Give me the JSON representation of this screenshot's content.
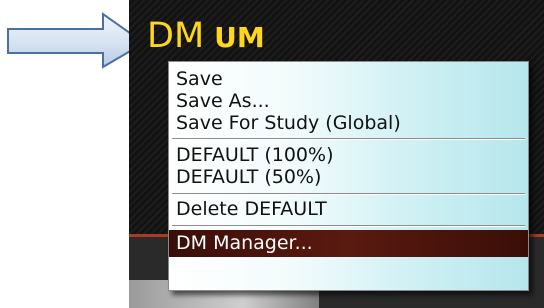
{
  "app": {
    "title_primary": "DM",
    "title_secondary": "UM"
  },
  "menu": {
    "items": [
      {
        "label": "Save"
      },
      {
        "label": "Save As..."
      },
      {
        "label": "Save For Study (Global)"
      },
      {
        "label": "DEFAULT (100%)"
      },
      {
        "label": "DEFAULT (50%)"
      },
      {
        "label": "Delete DEFAULT"
      },
      {
        "label": "DM Manager...",
        "selected": true
      }
    ]
  },
  "colors": {
    "title": "#ffd61a",
    "arrow_fill": "#d9e6f5",
    "arrow_stroke": "#4a6fa0",
    "menu_selected_bg": "#4a140c"
  }
}
